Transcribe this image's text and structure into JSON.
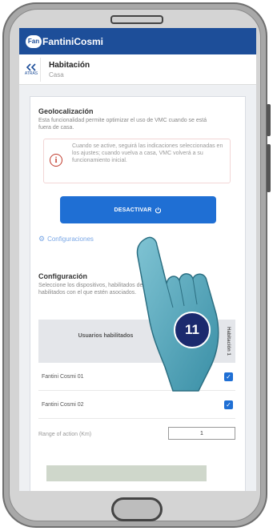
{
  "brand": {
    "logo_text": "FantiniCosmi",
    "badge": "Fan",
    "color": "#1d4e99"
  },
  "header": {
    "back_label": "ATRÁS",
    "title": "Habitación",
    "subtitle": "Casa"
  },
  "geolocation": {
    "title": "Geolocalización",
    "description": "Esta funcionalidad permite optimizar el uso de VMC cuando se está fuera de casa.",
    "notice": "Cuando se active, seguirá las indicaciones seleccionadas en los ajustes; cuando vuelva a casa, VMC volverá a su funcionamiento inicial.",
    "deactivate_label": "DESACTIVAR",
    "config_link": "Configuraciones"
  },
  "configuration": {
    "title": "Configuración",
    "description": "Seleccione los dispositivos, habilitados de los usuarios, los Unidad habilitados con el que estén asociados.",
    "table": {
      "col_users": "Usuarios habilitados",
      "col_vertical": "Habitación 1",
      "rows": [
        {
          "name": "Fantini Cosmi 01",
          "checked": true
        },
        {
          "name": "Fantini Cosmi 02",
          "checked": true
        }
      ]
    },
    "range_label": "Range of action (Km)",
    "range_value": "1"
  },
  "overlay": {
    "step_number": "11"
  }
}
